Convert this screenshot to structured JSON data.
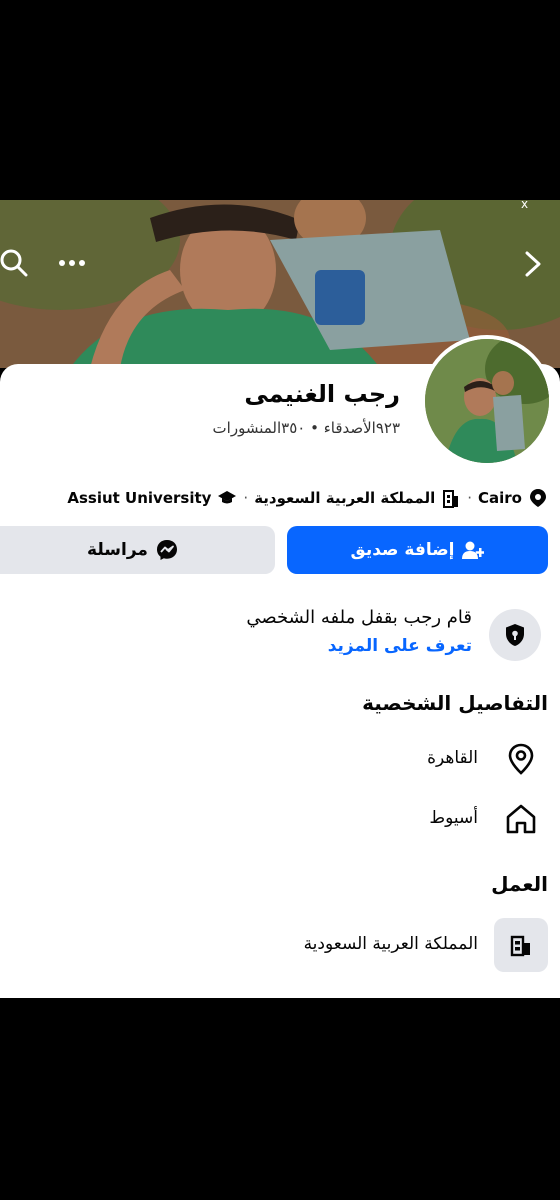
{
  "profile": {
    "name": "رجب الغنيمى",
    "stats": "٩٢٣الأصدقاء • ٣٥٠المنشورات"
  },
  "info": {
    "city": "Cairo",
    "workplace": "المملكة العربية السعودية",
    "school": "Assiut University"
  },
  "actions": {
    "add_friend": "إضافة صديق",
    "message": "مراسلة"
  },
  "lock_notice": {
    "text": "قام رجب بقفل ملفه الشخصي",
    "learn_more": "تعرف على المزيد"
  },
  "details": {
    "title": "التفاصيل الشخصية",
    "current_city": "القاهرة",
    "hometown": "أسيوط"
  },
  "work": {
    "title": "العمل",
    "employer": "المملكة العربية السعودية"
  },
  "colors": {
    "accent": "#0866ff",
    "secondary_button": "#e4e6eb",
    "text": "#050505"
  },
  "icons": [
    "search-icon",
    "more-icon",
    "chevron-right-icon",
    "location-icon",
    "building-icon",
    "graduation-cap-icon",
    "add-friend-icon",
    "messenger-icon",
    "shield-lock-icon",
    "home-icon"
  ]
}
